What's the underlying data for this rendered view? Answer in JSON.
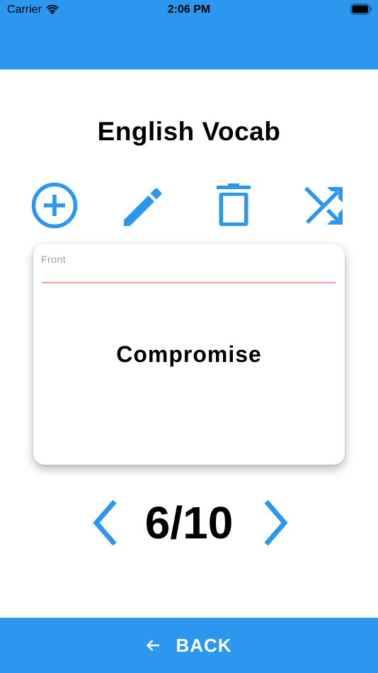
{
  "status_bar": {
    "carrier": "Carrier",
    "time": "2:06 PM"
  },
  "deck": {
    "title": "English Vocab"
  },
  "toolbar": {
    "icons": [
      "add-circle-icon",
      "pencil-icon",
      "trash-icon",
      "shuffle-icon"
    ]
  },
  "card": {
    "side_label": "Front",
    "text": "Compromise"
  },
  "pager": {
    "counter": "6/10",
    "current": 6,
    "total": 10
  },
  "footer": {
    "back_label": "BACK"
  },
  "colors": {
    "primary": "#2b97ef",
    "underline": "#ee9a9a",
    "label": "#9a9a9a"
  }
}
